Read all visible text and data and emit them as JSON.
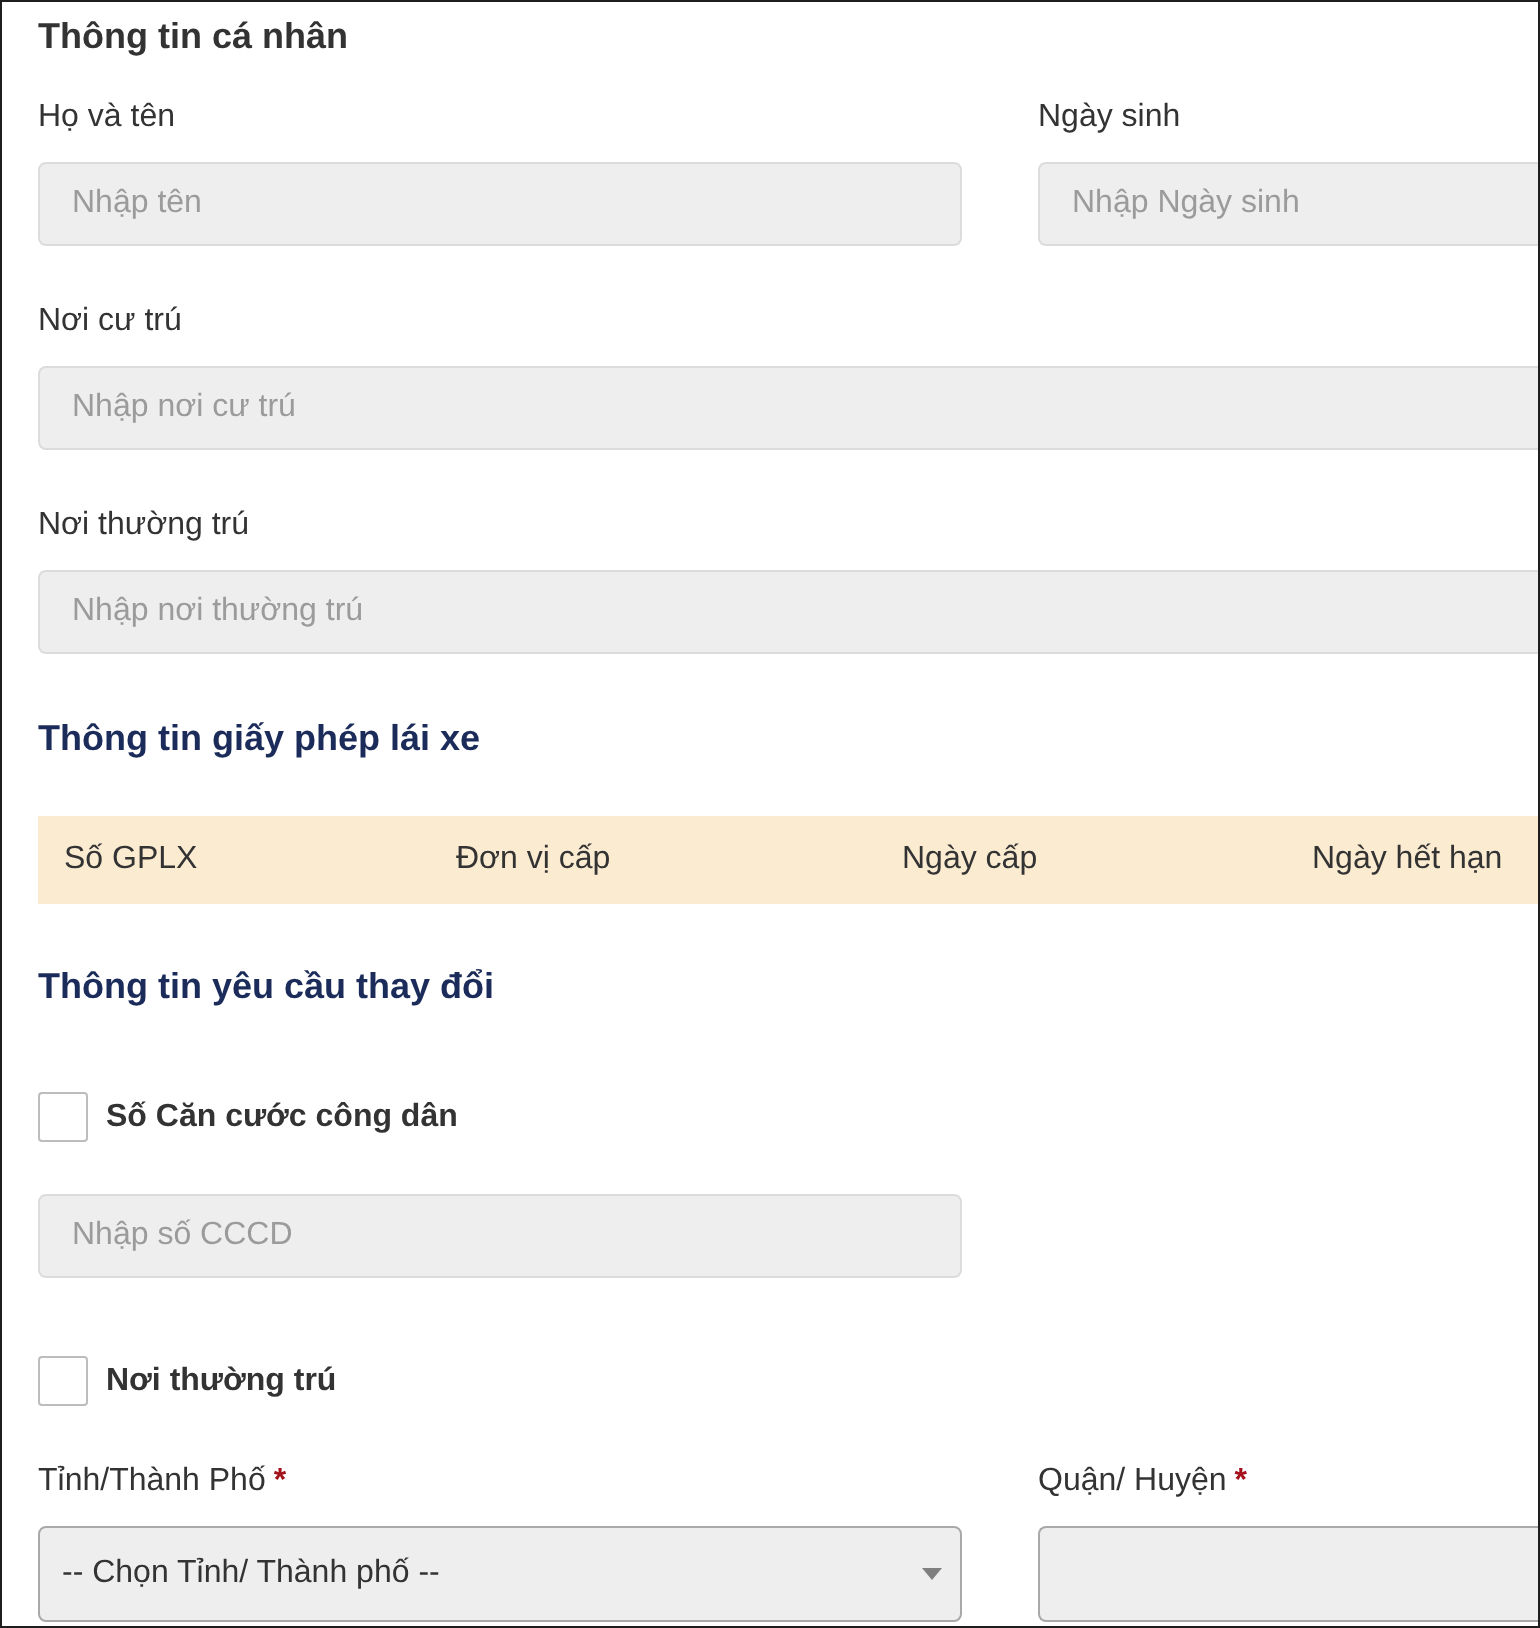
{
  "personal_info": {
    "title": "Thông tin cá nhân",
    "rows": [
      [
        {
          "label": "Họ và tên",
          "placeholder": "Nhập tên"
        },
        {
          "label": "Ngày sinh",
          "placeholder": "Nhập Ngày sinh"
        }
      ],
      [
        {
          "label": "Nơi cư trú",
          "placeholder": "Nhập nơi cư trú"
        }
      ],
      [
        {
          "label": "Nơi thường trú",
          "placeholder": "Nhập nơi thường trú"
        }
      ]
    ]
  },
  "license_info": {
    "title": "Thông tin giấy phép lái xe",
    "table": {
      "columns": [
        "Số GPLX",
        "Đơn vị cấp",
        "Ngày cấp",
        "Ngày hết hạn"
      ]
    }
  },
  "change_request": {
    "title": "Thông tin yêu cầu thay đổi",
    "options": [
      {
        "label": "Số Căn cước công dân",
        "checked": false,
        "fields": [
          {
            "kind": "text",
            "placeholder": "Nhập số CCCD"
          }
        ]
      },
      {
        "label": "Nơi thường trú",
        "checked": false,
        "fields": [
          {
            "kind": "select",
            "label": "Tỉnh/Thành Phố",
            "required_mark": "*",
            "value": "-- Chọn Tỉnh/ Thành phố --"
          },
          {
            "kind": "select",
            "label": "Quận/ Huyện",
            "required_mark": "*"
          }
        ]
      }
    ]
  }
}
